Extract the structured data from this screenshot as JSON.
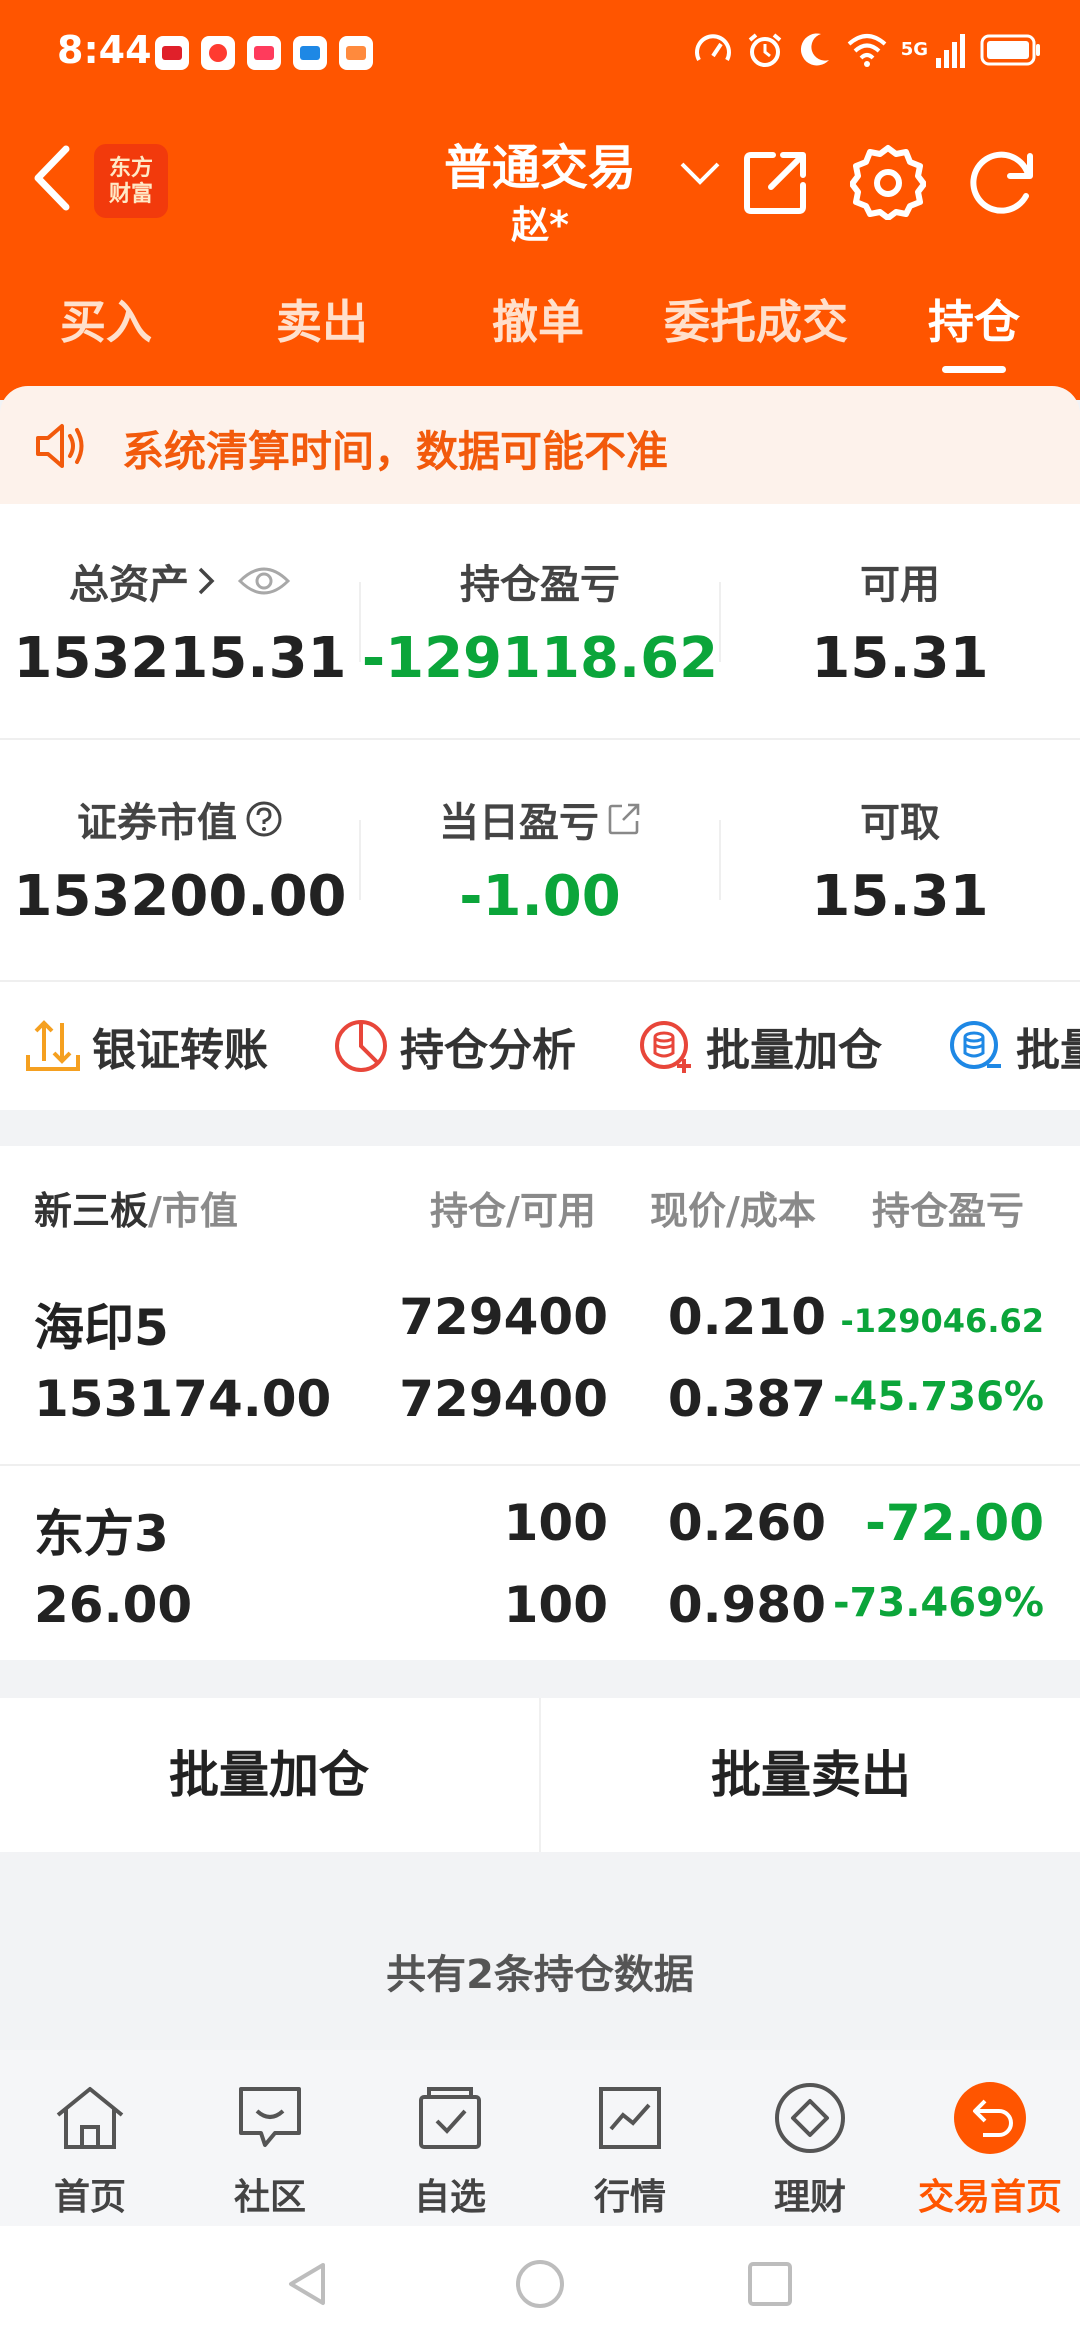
{
  "status_bar": {
    "time": "8:44",
    "network": "5G"
  },
  "header": {
    "logo_line1": "东方",
    "logo_line2": "财富",
    "title": "普通交易",
    "account": "赵*"
  },
  "trade_tabs": [
    {
      "label": "买入"
    },
    {
      "label": "卖出"
    },
    {
      "label": "撤单"
    },
    {
      "label": "委托成交"
    },
    {
      "label": "持仓",
      "active": true
    }
  ],
  "notice": {
    "text": "系统清算时间，数据可能不准"
  },
  "assets": {
    "total_assets": {
      "label": "总资产",
      "value": "153215.31"
    },
    "position_pl": {
      "label": "持仓盈亏",
      "value": "-129118.62"
    },
    "available": {
      "label": "可用",
      "value": "15.31"
    },
    "market_value": {
      "label": "证券市值",
      "value": "153200.00"
    },
    "daily_pl": {
      "label": "当日盈亏",
      "value": "-1.00"
    },
    "withdrawable": {
      "label": "可取",
      "value": "15.31"
    }
  },
  "tools": [
    {
      "label": "银证转账"
    },
    {
      "label": "持仓分析"
    },
    {
      "label": "批量加仓"
    },
    {
      "label": "批量"
    }
  ],
  "holdings": {
    "headers": {
      "market": "新三板",
      "market_sub": "/市值",
      "qty": "持仓/可用",
      "price": "现价/成本",
      "pl": "持仓盈亏"
    },
    "rows": [
      {
        "name": "海印5",
        "market_value": "153174.00",
        "position": "729400",
        "available": "729400",
        "price": "0.210",
        "cost": "0.387",
        "pl": "-129046.62",
        "pl_pct": "-45.736%"
      },
      {
        "name": "东方3",
        "market_value": "26.00",
        "position": "100",
        "available": "100",
        "price": "0.260",
        "cost": "0.980",
        "pl": "-72.00",
        "pl_pct": "-73.469%"
      }
    ]
  },
  "batch": {
    "add": "批量加仓",
    "sell": "批量卖出"
  },
  "summary": {
    "count_text": "共有2条持仓数据"
  },
  "bottom_nav": [
    {
      "label": "首页",
      "icon": "home-icon"
    },
    {
      "label": "社区",
      "icon": "chat-icon"
    },
    {
      "label": "自选",
      "icon": "watchlist-icon"
    },
    {
      "label": "行情",
      "icon": "chart-icon"
    },
    {
      "label": "理财",
      "icon": "diamond-icon"
    },
    {
      "label": "交易首页",
      "icon": "trade-home-icon",
      "active": true
    }
  ],
  "colors": {
    "brand": "#ff5500",
    "loss_green": "#0ba53a",
    "notice_text": "#f25a0c"
  }
}
